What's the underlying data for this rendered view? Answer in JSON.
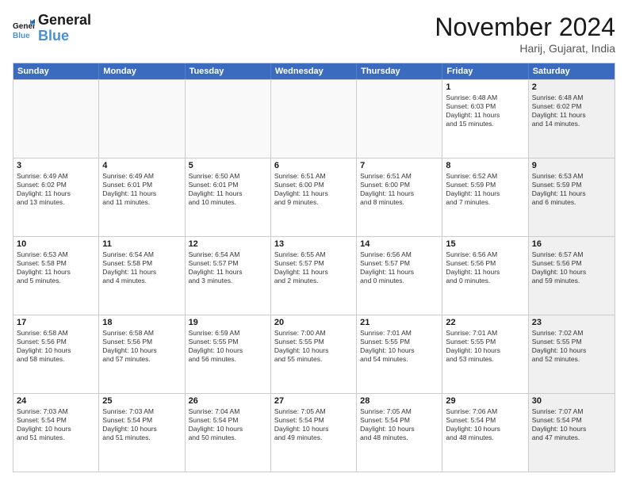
{
  "header": {
    "logo_line1": "General",
    "logo_line2": "Blue",
    "month_title": "November 2024",
    "location": "Harij, Gujarat, India"
  },
  "weekdays": [
    "Sunday",
    "Monday",
    "Tuesday",
    "Wednesday",
    "Thursday",
    "Friday",
    "Saturday"
  ],
  "rows": [
    [
      {
        "day": "",
        "info": "",
        "empty": true
      },
      {
        "day": "",
        "info": "",
        "empty": true
      },
      {
        "day": "",
        "info": "",
        "empty": true
      },
      {
        "day": "",
        "info": "",
        "empty": true
      },
      {
        "day": "",
        "info": "",
        "empty": true
      },
      {
        "day": "1",
        "info": "Sunrise: 6:48 AM\nSunset: 6:03 PM\nDaylight: 11 hours\nand 15 minutes.",
        "empty": false
      },
      {
        "day": "2",
        "info": "Sunrise: 6:48 AM\nSunset: 6:02 PM\nDaylight: 11 hours\nand 14 minutes.",
        "empty": false,
        "shaded": true
      }
    ],
    [
      {
        "day": "3",
        "info": "Sunrise: 6:49 AM\nSunset: 6:02 PM\nDaylight: 11 hours\nand 13 minutes.",
        "empty": false
      },
      {
        "day": "4",
        "info": "Sunrise: 6:49 AM\nSunset: 6:01 PM\nDaylight: 11 hours\nand 11 minutes.",
        "empty": false
      },
      {
        "day": "5",
        "info": "Sunrise: 6:50 AM\nSunset: 6:01 PM\nDaylight: 11 hours\nand 10 minutes.",
        "empty": false
      },
      {
        "day": "6",
        "info": "Sunrise: 6:51 AM\nSunset: 6:00 PM\nDaylight: 11 hours\nand 9 minutes.",
        "empty": false
      },
      {
        "day": "7",
        "info": "Sunrise: 6:51 AM\nSunset: 6:00 PM\nDaylight: 11 hours\nand 8 minutes.",
        "empty": false
      },
      {
        "day": "8",
        "info": "Sunrise: 6:52 AM\nSunset: 5:59 PM\nDaylight: 11 hours\nand 7 minutes.",
        "empty": false
      },
      {
        "day": "9",
        "info": "Sunrise: 6:53 AM\nSunset: 5:59 PM\nDaylight: 11 hours\nand 6 minutes.",
        "empty": false,
        "shaded": true
      }
    ],
    [
      {
        "day": "10",
        "info": "Sunrise: 6:53 AM\nSunset: 5:58 PM\nDaylight: 11 hours\nand 5 minutes.",
        "empty": false
      },
      {
        "day": "11",
        "info": "Sunrise: 6:54 AM\nSunset: 5:58 PM\nDaylight: 11 hours\nand 4 minutes.",
        "empty": false
      },
      {
        "day": "12",
        "info": "Sunrise: 6:54 AM\nSunset: 5:57 PM\nDaylight: 11 hours\nand 3 minutes.",
        "empty": false
      },
      {
        "day": "13",
        "info": "Sunrise: 6:55 AM\nSunset: 5:57 PM\nDaylight: 11 hours\nand 2 minutes.",
        "empty": false
      },
      {
        "day": "14",
        "info": "Sunrise: 6:56 AM\nSunset: 5:57 PM\nDaylight: 11 hours\nand 0 minutes.",
        "empty": false
      },
      {
        "day": "15",
        "info": "Sunrise: 6:56 AM\nSunset: 5:56 PM\nDaylight: 11 hours\nand 0 minutes.",
        "empty": false
      },
      {
        "day": "16",
        "info": "Sunrise: 6:57 AM\nSunset: 5:56 PM\nDaylight: 10 hours\nand 59 minutes.",
        "empty": false,
        "shaded": true
      }
    ],
    [
      {
        "day": "17",
        "info": "Sunrise: 6:58 AM\nSunset: 5:56 PM\nDaylight: 10 hours\nand 58 minutes.",
        "empty": false
      },
      {
        "day": "18",
        "info": "Sunrise: 6:58 AM\nSunset: 5:56 PM\nDaylight: 10 hours\nand 57 minutes.",
        "empty": false
      },
      {
        "day": "19",
        "info": "Sunrise: 6:59 AM\nSunset: 5:55 PM\nDaylight: 10 hours\nand 56 minutes.",
        "empty": false
      },
      {
        "day": "20",
        "info": "Sunrise: 7:00 AM\nSunset: 5:55 PM\nDaylight: 10 hours\nand 55 minutes.",
        "empty": false
      },
      {
        "day": "21",
        "info": "Sunrise: 7:01 AM\nSunset: 5:55 PM\nDaylight: 10 hours\nand 54 minutes.",
        "empty": false
      },
      {
        "day": "22",
        "info": "Sunrise: 7:01 AM\nSunset: 5:55 PM\nDaylight: 10 hours\nand 53 minutes.",
        "empty": false
      },
      {
        "day": "23",
        "info": "Sunrise: 7:02 AM\nSunset: 5:55 PM\nDaylight: 10 hours\nand 52 minutes.",
        "empty": false,
        "shaded": true
      }
    ],
    [
      {
        "day": "24",
        "info": "Sunrise: 7:03 AM\nSunset: 5:54 PM\nDaylight: 10 hours\nand 51 minutes.",
        "empty": false
      },
      {
        "day": "25",
        "info": "Sunrise: 7:03 AM\nSunset: 5:54 PM\nDaylight: 10 hours\nand 51 minutes.",
        "empty": false
      },
      {
        "day": "26",
        "info": "Sunrise: 7:04 AM\nSunset: 5:54 PM\nDaylight: 10 hours\nand 50 minutes.",
        "empty": false
      },
      {
        "day": "27",
        "info": "Sunrise: 7:05 AM\nSunset: 5:54 PM\nDaylight: 10 hours\nand 49 minutes.",
        "empty": false
      },
      {
        "day": "28",
        "info": "Sunrise: 7:05 AM\nSunset: 5:54 PM\nDaylight: 10 hours\nand 48 minutes.",
        "empty": false
      },
      {
        "day": "29",
        "info": "Sunrise: 7:06 AM\nSunset: 5:54 PM\nDaylight: 10 hours\nand 48 minutes.",
        "empty": false
      },
      {
        "day": "30",
        "info": "Sunrise: 7:07 AM\nSunset: 5:54 PM\nDaylight: 10 hours\nand 47 minutes.",
        "empty": false,
        "shaded": true
      }
    ]
  ]
}
